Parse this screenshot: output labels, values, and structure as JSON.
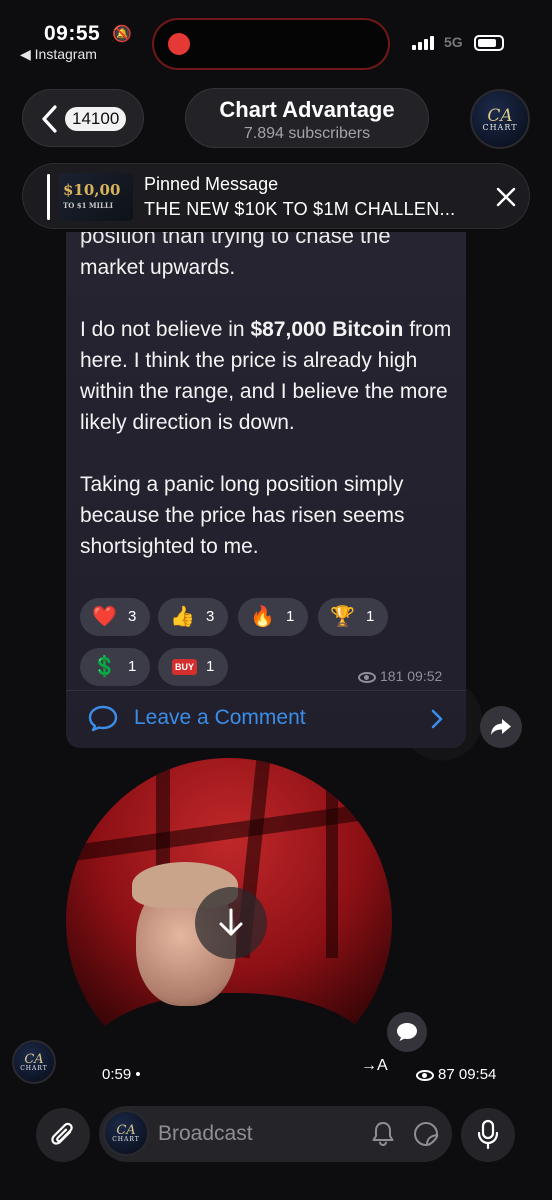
{
  "status_bar": {
    "time": "09:55",
    "back_app": "◀ Instagram",
    "network": "5G"
  },
  "header": {
    "back_count": "14100",
    "channel_title": "Chart Advantage",
    "subscribers": "7.894 subscribers",
    "avatar_monogram": "CA",
    "avatar_word": "CHART"
  },
  "pinned": {
    "label": "Pinned Message",
    "text": "THE NEW $10K TO $1M CHALLEN...",
    "thumb_line1": "$10,00",
    "thumb_line2": "TO $1 MILLI"
  },
  "message": {
    "cut_line": "position than trying to chase the",
    "line_first": "market upwards.",
    "para2_before": "I do not believe in ",
    "para2_bold": "$87,000 Bitcoin",
    "para2_after": " from here. I think the price is already high within the range, and I believe the more likely direction is down.",
    "para3": "Taking a panic long position simply because the price has risen seems shortsighted to me.",
    "reactions": [
      {
        "icon": "heart-icon",
        "emoji": "❤️",
        "count": "3"
      },
      {
        "icon": "thumbs-up-icon",
        "emoji": "👍",
        "count": "3"
      },
      {
        "icon": "fire-icon",
        "emoji": "🔥",
        "count": "1"
      },
      {
        "icon": "trophy-icon",
        "emoji": "🏆",
        "count": "1"
      },
      {
        "icon": "dollar-icon",
        "emoji": "💲",
        "count": "1"
      },
      {
        "icon": "buy-icon",
        "emoji": "BUY",
        "count": "1"
      }
    ],
    "views": "181",
    "time": "09:52",
    "comment_label": "Leave a Comment"
  },
  "video": {
    "duration": "0:59 •",
    "translate": "→A",
    "views": "87",
    "time": "09:54"
  },
  "input": {
    "placeholder": "Broadcast"
  },
  "colors": {
    "accent": "#3a8de8",
    "record": "#e53935",
    "bubble": "#252330"
  }
}
